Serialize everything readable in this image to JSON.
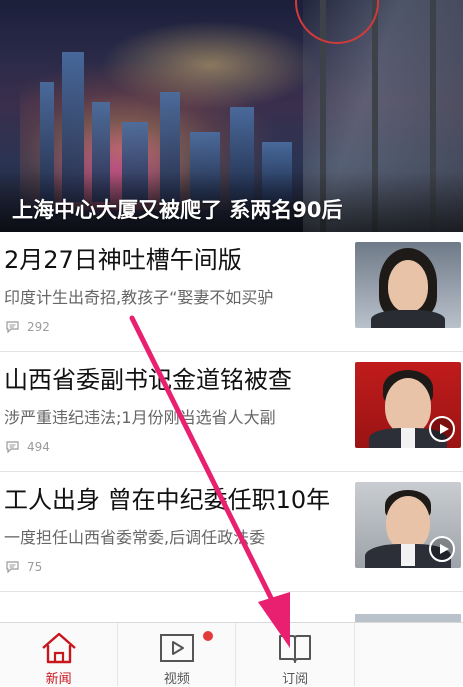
{
  "hero": {
    "title": "上海中心大厦又被爬了 系两名90后"
  },
  "articles": [
    {
      "title": "2月27日神吐槽午间版",
      "summary": "印度计生出奇招,教孩子“娶妻不如买驴",
      "comments": "292",
      "has_video": false
    },
    {
      "title": "山西省委副书记金道铭被查",
      "summary": "涉严重违纪违法;1月份刚当选省人大副",
      "comments": "494",
      "has_video": true
    },
    {
      "title": "工人出身 曾在中纪委任职10年",
      "summary": "一度担任山西省委常委,后调任政法委",
      "comments": "75",
      "has_video": true
    }
  ],
  "bottom_nav": {
    "items": [
      {
        "label": "新闻",
        "icon": "home-icon",
        "active": true
      },
      {
        "label": "视频",
        "icon": "video-play-icon",
        "active": false,
        "badge": true
      },
      {
        "label": "订阅",
        "icon": "book-icon",
        "active": false
      },
      {
        "label": "",
        "icon": "",
        "active": false
      }
    ]
  },
  "colors": {
    "accent": "#c8161d",
    "annotation_arrow": "#e8206f",
    "badge": "#e23b3b"
  }
}
